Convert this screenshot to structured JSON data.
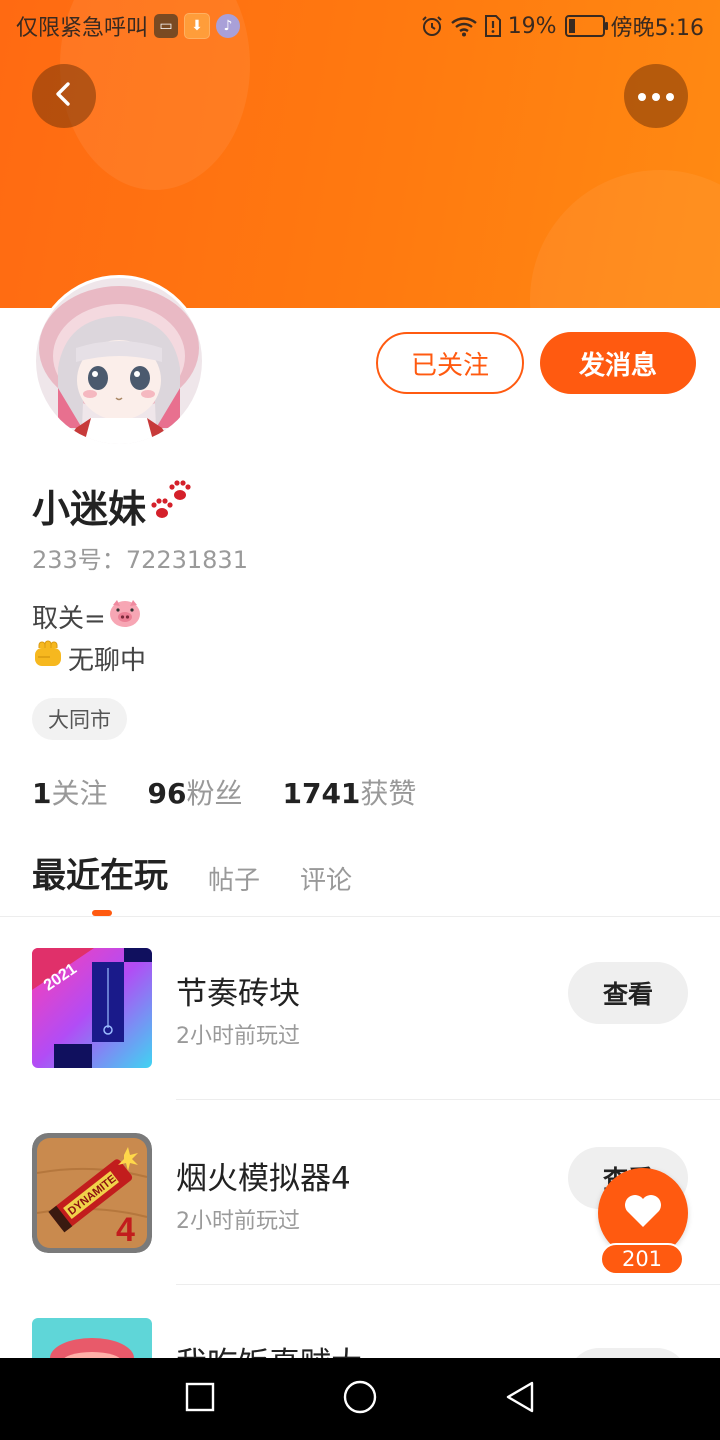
{
  "status_bar": {
    "carrier": "仅限紧急呼叫",
    "battery": "19%",
    "battery_level": 0.19,
    "time": "傍晚5:16"
  },
  "header": {
    "back_icon": "chevron-left-icon",
    "more_icon": "more-dots-icon"
  },
  "profile": {
    "name": "小迷妹",
    "id_label": "233号：",
    "id_value": "72231831",
    "bio_line1": "取关=",
    "bio_line2": "无聊中",
    "location": "大同市",
    "follow_button": "已关注",
    "message_button": "发消息"
  },
  "stats": {
    "following_count": "1",
    "following_label": "关注",
    "fans_count": "96",
    "fans_label": "粉丝",
    "likes_count": "1741",
    "likes_label": "获赞"
  },
  "tabs": [
    {
      "label": "最近在玩",
      "active": true
    },
    {
      "label": "帖子",
      "active": false
    },
    {
      "label": "评论",
      "active": false
    }
  ],
  "games": [
    {
      "name": "节奏砖块",
      "time": "2小时前玩过",
      "button": "查看",
      "badge": "2021"
    },
    {
      "name": "烟火模拟器4",
      "time": "2小时前玩过",
      "button": "查看",
      "badge": "4"
    },
    {
      "name": "我吃饭真贼大",
      "time": "",
      "button": ""
    }
  ],
  "fab": {
    "count": "201",
    "icon": "heart-icon"
  },
  "colors": {
    "brand": "#ff5a10",
    "banner": "#ff7a10"
  }
}
